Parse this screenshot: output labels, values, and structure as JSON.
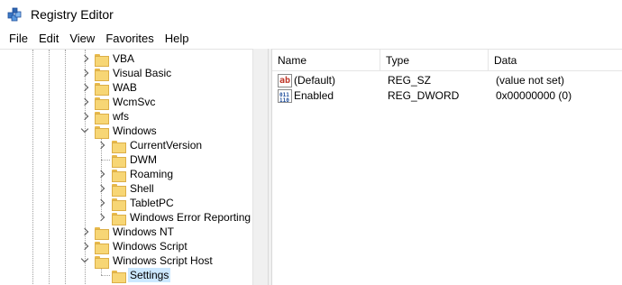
{
  "window": {
    "title": "Registry Editor",
    "icon": "registry-editor-icon"
  },
  "menu": [
    "File",
    "Edit",
    "View",
    "Favorites",
    "Help"
  ],
  "tree": [
    {
      "label": "VBA",
      "level": 1,
      "expander": "collapsed",
      "selected": false
    },
    {
      "label": "Visual Basic",
      "level": 1,
      "expander": "collapsed",
      "selected": false
    },
    {
      "label": "WAB",
      "level": 1,
      "expander": "collapsed",
      "selected": false
    },
    {
      "label": "WcmSvc",
      "level": 1,
      "expander": "collapsed",
      "selected": false
    },
    {
      "label": "wfs",
      "level": 1,
      "expander": "collapsed",
      "selected": false
    },
    {
      "label": "Windows",
      "level": 1,
      "expander": "expanded",
      "selected": false
    },
    {
      "label": "CurrentVersion",
      "level": 2,
      "expander": "collapsed",
      "selected": false
    },
    {
      "label": "DWM",
      "level": 2,
      "expander": "none",
      "selected": false
    },
    {
      "label": "Roaming",
      "level": 2,
      "expander": "collapsed",
      "selected": false
    },
    {
      "label": "Shell",
      "level": 2,
      "expander": "collapsed",
      "selected": false
    },
    {
      "label": "TabletPC",
      "level": 2,
      "expander": "collapsed",
      "selected": false
    },
    {
      "label": "Windows Error Reporting",
      "level": 2,
      "expander": "collapsed",
      "selected": false
    },
    {
      "label": "Windows NT",
      "level": 1,
      "expander": "collapsed",
      "selected": false
    },
    {
      "label": "Windows Script",
      "level": 1,
      "expander": "collapsed",
      "selected": false
    },
    {
      "label": "Windows Script Host",
      "level": 1,
      "expander": "expanded",
      "selected": false
    },
    {
      "label": "Settings",
      "level": 2,
      "expander": "none",
      "selected": true
    }
  ],
  "list": {
    "columns": [
      "Name",
      "Type",
      "Data"
    ],
    "rows": [
      {
        "name": "(Default)",
        "type": "REG_SZ",
        "data": "(value not set)",
        "icon": "string-value-icon"
      },
      {
        "name": "Enabled",
        "type": "REG_DWORD",
        "data": "0x00000000 (0)",
        "icon": "binary-value-icon"
      }
    ]
  },
  "icons": {
    "string_value_glyph": "ab",
    "dword_value_glyph": "011\n110"
  },
  "colors": {
    "selection": "#cce8ff",
    "folder": "#f7d675"
  }
}
